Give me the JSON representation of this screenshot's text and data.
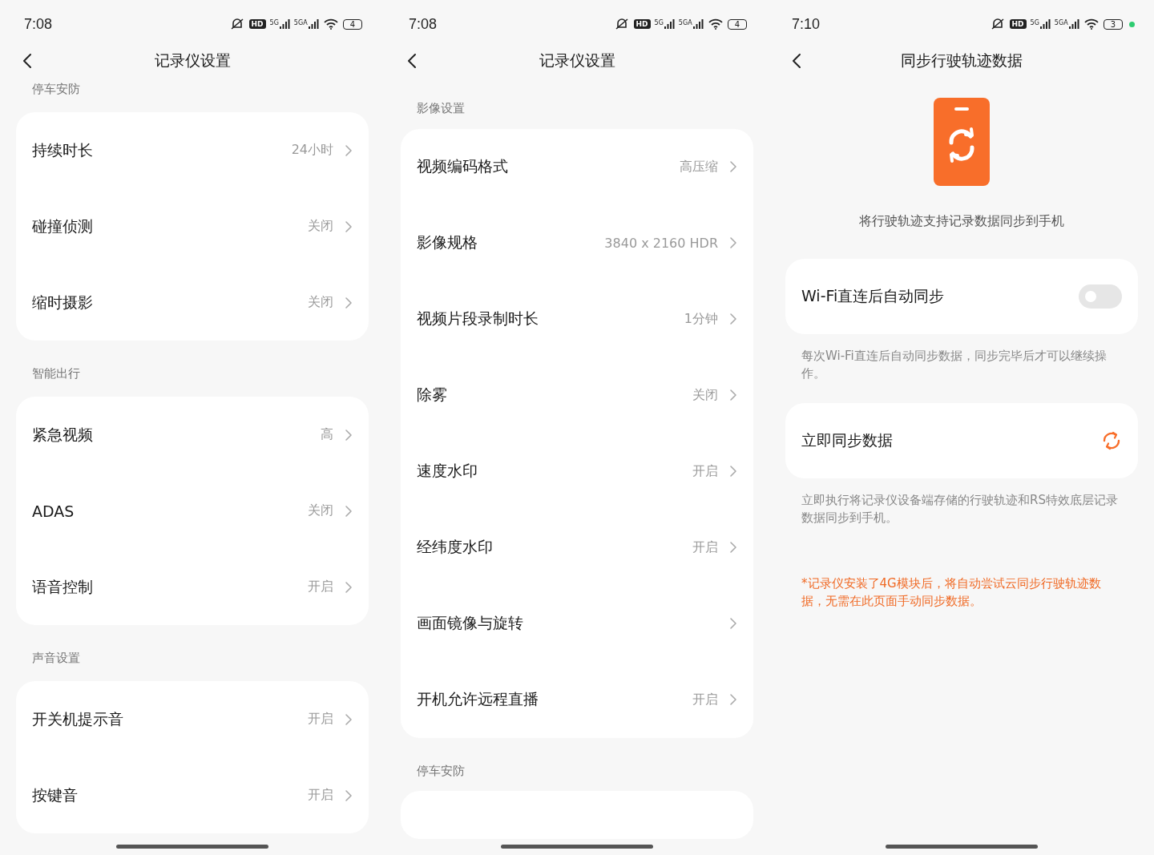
{
  "screens": [
    {
      "kind": "settings",
      "status_bar": {
        "time": "7:08",
        "hd": "HD",
        "net_1": "5G",
        "net_2": "5GA",
        "battery": "4",
        "dot": false
      },
      "title": "记录仪设置",
      "sections": [
        {
          "header": "停车安防",
          "rows": [
            {
              "label": "持续时长",
              "value": "24小时"
            },
            {
              "label": "碰撞侦测",
              "value": "关闭"
            },
            {
              "label": "缩时摄影",
              "value": "关闭"
            }
          ]
        },
        {
          "header": "智能出行",
          "rows": [
            {
              "label": "紧急视频",
              "value": "高"
            },
            {
              "label": "ADAS",
              "value": "关闭"
            },
            {
              "label": "语音控制",
              "value": "开启"
            }
          ]
        },
        {
          "header": "声音设置",
          "rows": [
            {
              "label": "开关机提示音",
              "value": "开启"
            },
            {
              "label": "按键音",
              "value": "开启"
            }
          ]
        }
      ]
    },
    {
      "kind": "settings",
      "status_bar": {
        "time": "7:08",
        "hd": "HD",
        "net_1": "5G",
        "net_2": "5GA",
        "battery": "4",
        "dot": false
      },
      "title": "记录仪设置",
      "sections": [
        {
          "header": "影像设置",
          "rows": [
            {
              "label": "视频编码格式",
              "value": "高压缩"
            },
            {
              "label": "影像规格",
              "value": "3840 x 2160 HDR"
            },
            {
              "label": "视频片段录制时长",
              "value": "1分钟"
            },
            {
              "label": "除雾",
              "value": "关闭"
            },
            {
              "label": "速度水印",
              "value": "开启"
            },
            {
              "label": "经纬度水印",
              "value": "开启"
            },
            {
              "label": "画面镜像与旋转"
            },
            {
              "label": "开机允许远程直播",
              "value": "开启"
            }
          ]
        },
        {
          "header": "停车安防"
        }
      ]
    },
    {
      "kind": "sync",
      "status_bar": {
        "time": "7:10",
        "hd": "HD",
        "net_1": "5G",
        "net_2": "5GA",
        "battery": "3",
        "dot": true
      },
      "title": "同步行驶轨迹数据",
      "blocks": [
        {
          "kind": "hero",
          "text": "将行驶轨迹支持记录数据同步到手机"
        },
        {
          "kind": "toggle",
          "label": "Wi-Fi直连后自动同步",
          "on": false
        },
        {
          "kind": "note",
          "text": "每次Wi-Fi直连后自动同步数据，同步完毕后才可以继续操作。"
        },
        {
          "kind": "action",
          "label": "立即同步数据"
        },
        {
          "kind": "note",
          "text": "立即执行将记录仪设备端存储的行驶轨迹和RS特效底层记录数据同步到手机。"
        },
        {
          "kind": "warning",
          "text": "*记录仪安装了4G模块后，将自动尝试云同步行驶轨迹数据，无需在此页面手动同步数据。"
        }
      ]
    }
  ]
}
